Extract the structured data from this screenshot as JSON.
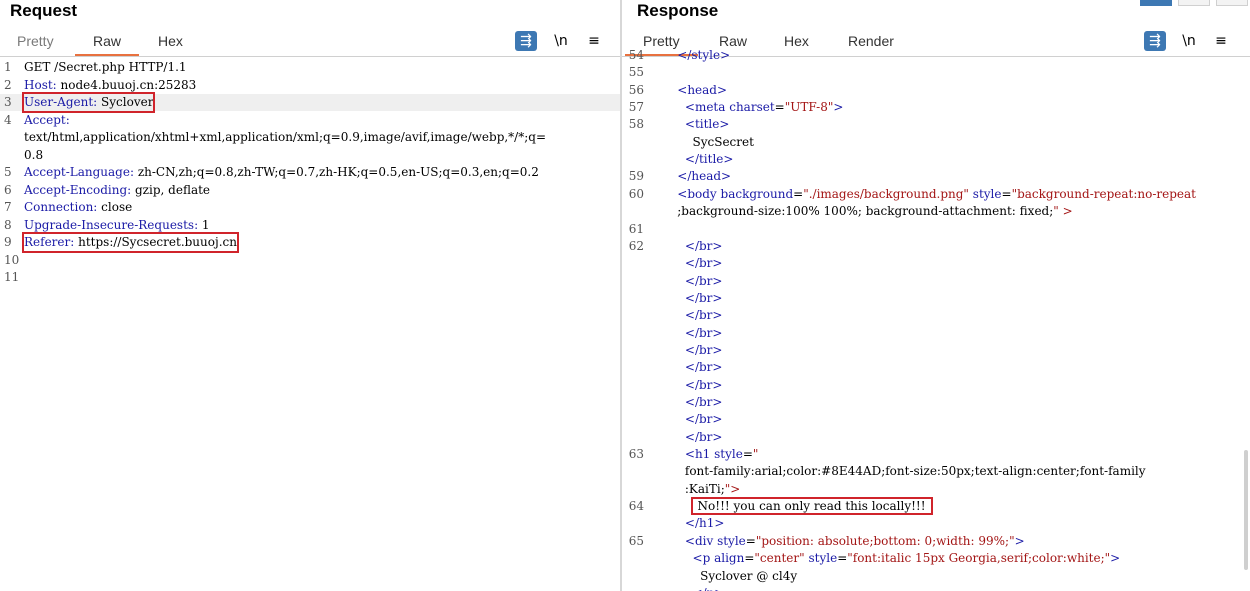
{
  "request": {
    "title": "Request",
    "tabs": [
      "Pretty",
      "Raw",
      "Hex"
    ],
    "active_tab": "Raw",
    "lines": [
      {
        "n": "1",
        "key": "",
        "text": "GET /Secret.php HTTP/1.1"
      },
      {
        "n": "2",
        "key": "Host:",
        "text": " node4.buuoj.cn:25283"
      },
      {
        "n": "3",
        "key": "User-Agent:",
        "text": " Syclover"
      },
      {
        "n": "4",
        "key": "Accept:",
        "text": ""
      },
      {
        "n": "",
        "key": "",
        "text": "text/html,application/xhtml+xml,application/xml;q=0.9,image/avif,image/webp,*/*;q="
      },
      {
        "n": "",
        "key": "",
        "text": "0.8"
      },
      {
        "n": "5",
        "key": "Accept-Language:",
        "text": " zh-CN,zh;q=0.8,zh-TW;q=0.7,zh-HK;q=0.5,en-US;q=0.3,en;q=0.2"
      },
      {
        "n": "6",
        "key": "Accept-Encoding:",
        "text": " gzip, deflate"
      },
      {
        "n": "7",
        "key": "Connection:",
        "text": " close"
      },
      {
        "n": "8",
        "key": "Upgrade-Insecure-Requests:",
        "text": " 1"
      },
      {
        "n": "9",
        "key": "Referer:",
        "text": " https://Sycsecret.buuoj.cn"
      },
      {
        "n": "10",
        "key": "",
        "text": ""
      },
      {
        "n": "11",
        "key": "",
        "text": ""
      }
    ]
  },
  "response": {
    "title": "Response",
    "tabs": [
      "Pretty",
      "Raw",
      "Hex",
      "Render"
    ],
    "active_tab": "Pretty",
    "lines": [
      {
        "n": "54",
        "text": "    </style>"
      },
      {
        "n": "55",
        "text": ""
      },
      {
        "n": "56",
        "text": "    <head>"
      },
      {
        "n": "57",
        "text": "      <meta charset=\"UTF-8\">"
      },
      {
        "n": "58",
        "text": "      <title>"
      },
      {
        "n": "",
        "text": "        SycSecret"
      },
      {
        "n": "",
        "text": "      </title>"
      },
      {
        "n": "59",
        "text": "    </head>"
      },
      {
        "n": "60",
        "text": "    <body background=\"./images/background.png\" style=\"background-repeat:no-repeat"
      },
      {
        "n": "",
        "text": "    ;background-size:100% 100%; background-attachment: fixed;\" >"
      },
      {
        "n": "61",
        "text": ""
      },
      {
        "n": "62",
        "text": "      </br>"
      },
      {
        "n": "",
        "text": "      </br>"
      },
      {
        "n": "",
        "text": "      </br>"
      },
      {
        "n": "",
        "text": "      </br>"
      },
      {
        "n": "",
        "text": "      </br>"
      },
      {
        "n": "",
        "text": "      </br>"
      },
      {
        "n": "",
        "text": "      </br>"
      },
      {
        "n": "",
        "text": "      </br>"
      },
      {
        "n": "",
        "text": "      </br>"
      },
      {
        "n": "",
        "text": "      </br>"
      },
      {
        "n": "",
        "text": "      </br>"
      },
      {
        "n": "",
        "text": "      </br>"
      },
      {
        "n": "63",
        "text": "      <h1 style=\""
      },
      {
        "n": "",
        "text": "      font-family:arial;color:#8E44AD;font-size:50px;text-align:center;font-family"
      },
      {
        "n": "",
        "text": "      :KaiTi;\">"
      },
      {
        "n": "64",
        "text": "        No!!! you can only read this locally!!!"
      },
      {
        "n": "",
        "text": "      </h1>"
      },
      {
        "n": "65",
        "text": "      <div style=\"position: absolute;bottom: 0;width: 99%;\">"
      },
      {
        "n": "",
        "text": "        <p align=\"center\" style=\"font:italic 15px Georgia,serif;color:white;\">"
      },
      {
        "n": "",
        "text": "          Syclover @ cl4y"
      },
      {
        "n": "",
        "text": "        </p>"
      }
    ]
  },
  "toolbar": {
    "wrap_icon": "word-wrap-icon",
    "newline_label": "\\n",
    "menu_icon": "≡"
  },
  "colors": {
    "accent": "#e8713f",
    "highlight_box": "#d0242b",
    "key": "#1a1aa6",
    "value": "#a31515"
  }
}
